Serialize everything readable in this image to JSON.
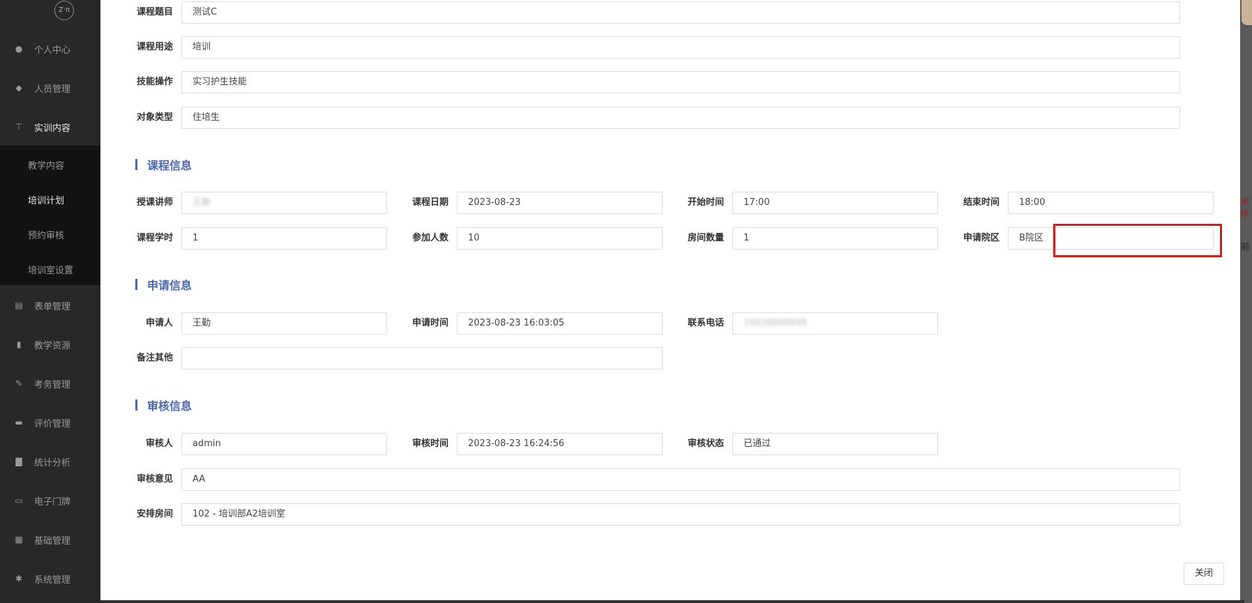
{
  "sidebar": {
    "logo": "Z·π",
    "items": [
      {
        "label": "个人中心",
        "icon": "user-icon",
        "glyph": "●"
      },
      {
        "label": "人员管理",
        "icon": "users-icon",
        "glyph": "◆"
      },
      {
        "label": "实训内容",
        "icon": "tree-icon",
        "glyph": "⊤"
      },
      {
        "label": "表单管理",
        "icon": "form-icon",
        "glyph": "▤"
      },
      {
        "label": "教学资源",
        "icon": "book-icon",
        "glyph": "▮"
      },
      {
        "label": "考务管理",
        "icon": "edit-icon",
        "glyph": "✎"
      },
      {
        "label": "评价管理",
        "icon": "rating-icon",
        "glyph": "▬"
      },
      {
        "label": "统计分析",
        "icon": "bar-chart-icon",
        "glyph": "▇"
      },
      {
        "label": "电子门牌",
        "icon": "monitor-icon",
        "glyph": "▭"
      },
      {
        "label": "基础管理",
        "icon": "grid-icon",
        "glyph": "▦"
      },
      {
        "label": "系统管理",
        "icon": "gear-icon",
        "glyph": "✱"
      }
    ],
    "submenu": [
      "教学内容",
      "培训计划",
      "预约审核",
      "培训室设置"
    ]
  },
  "right_strip": {
    "t1": "删除",
    "t2": "前"
  },
  "form": {
    "course_title": {
      "label": "课程题目",
      "value": "测试C"
    },
    "course_purpose": {
      "label": "课程用途",
      "value": "培训"
    },
    "skill_operation": {
      "label": "技能操作",
      "value": "实习护生技能"
    },
    "target_type": {
      "label": "对象类型",
      "value": "住培生"
    }
  },
  "course_info": {
    "title": "课程信息",
    "teacher": {
      "label": "授课讲师",
      "value": "王勤"
    },
    "course_date": {
      "label": "课程日期",
      "value": "2023-08-23"
    },
    "start_time": {
      "label": "开始时间",
      "value": "17:00"
    },
    "end_time": {
      "label": "结束时间",
      "value": "18:00"
    },
    "class_hours": {
      "label": "课程学时",
      "value": "1"
    },
    "participants": {
      "label": "参加人数",
      "value": "10"
    },
    "room_count": {
      "label": "房间数量",
      "value": "1"
    },
    "campus": {
      "label": "申请院区",
      "value": "B院区"
    }
  },
  "apply_info": {
    "title": "申请信息",
    "applicant": {
      "label": "申请人",
      "value": "王勤"
    },
    "apply_time": {
      "label": "申请时间",
      "value": "2023-08-23 16:03:05"
    },
    "phone": {
      "label": "联系电话",
      "value": "18838888888"
    },
    "remarks": {
      "label": "备注其他",
      "value": ""
    }
  },
  "review_info": {
    "title": "审核信息",
    "reviewer": {
      "label": "审核人",
      "value": "admin"
    },
    "review_time": {
      "label": "审核时间",
      "value": "2023-08-23 16:24:56"
    },
    "review_status": {
      "label": "审核状态",
      "value": "已通过"
    },
    "review_opinion": {
      "label": "审核意见",
      "value": "AA"
    },
    "room": {
      "label": "安排房间",
      "value": "102 - 培训部A2培训室"
    }
  },
  "buttons": {
    "close": "关闭"
  },
  "colors": {
    "accent": "#4a67b0",
    "highlight": "#e01818"
  }
}
